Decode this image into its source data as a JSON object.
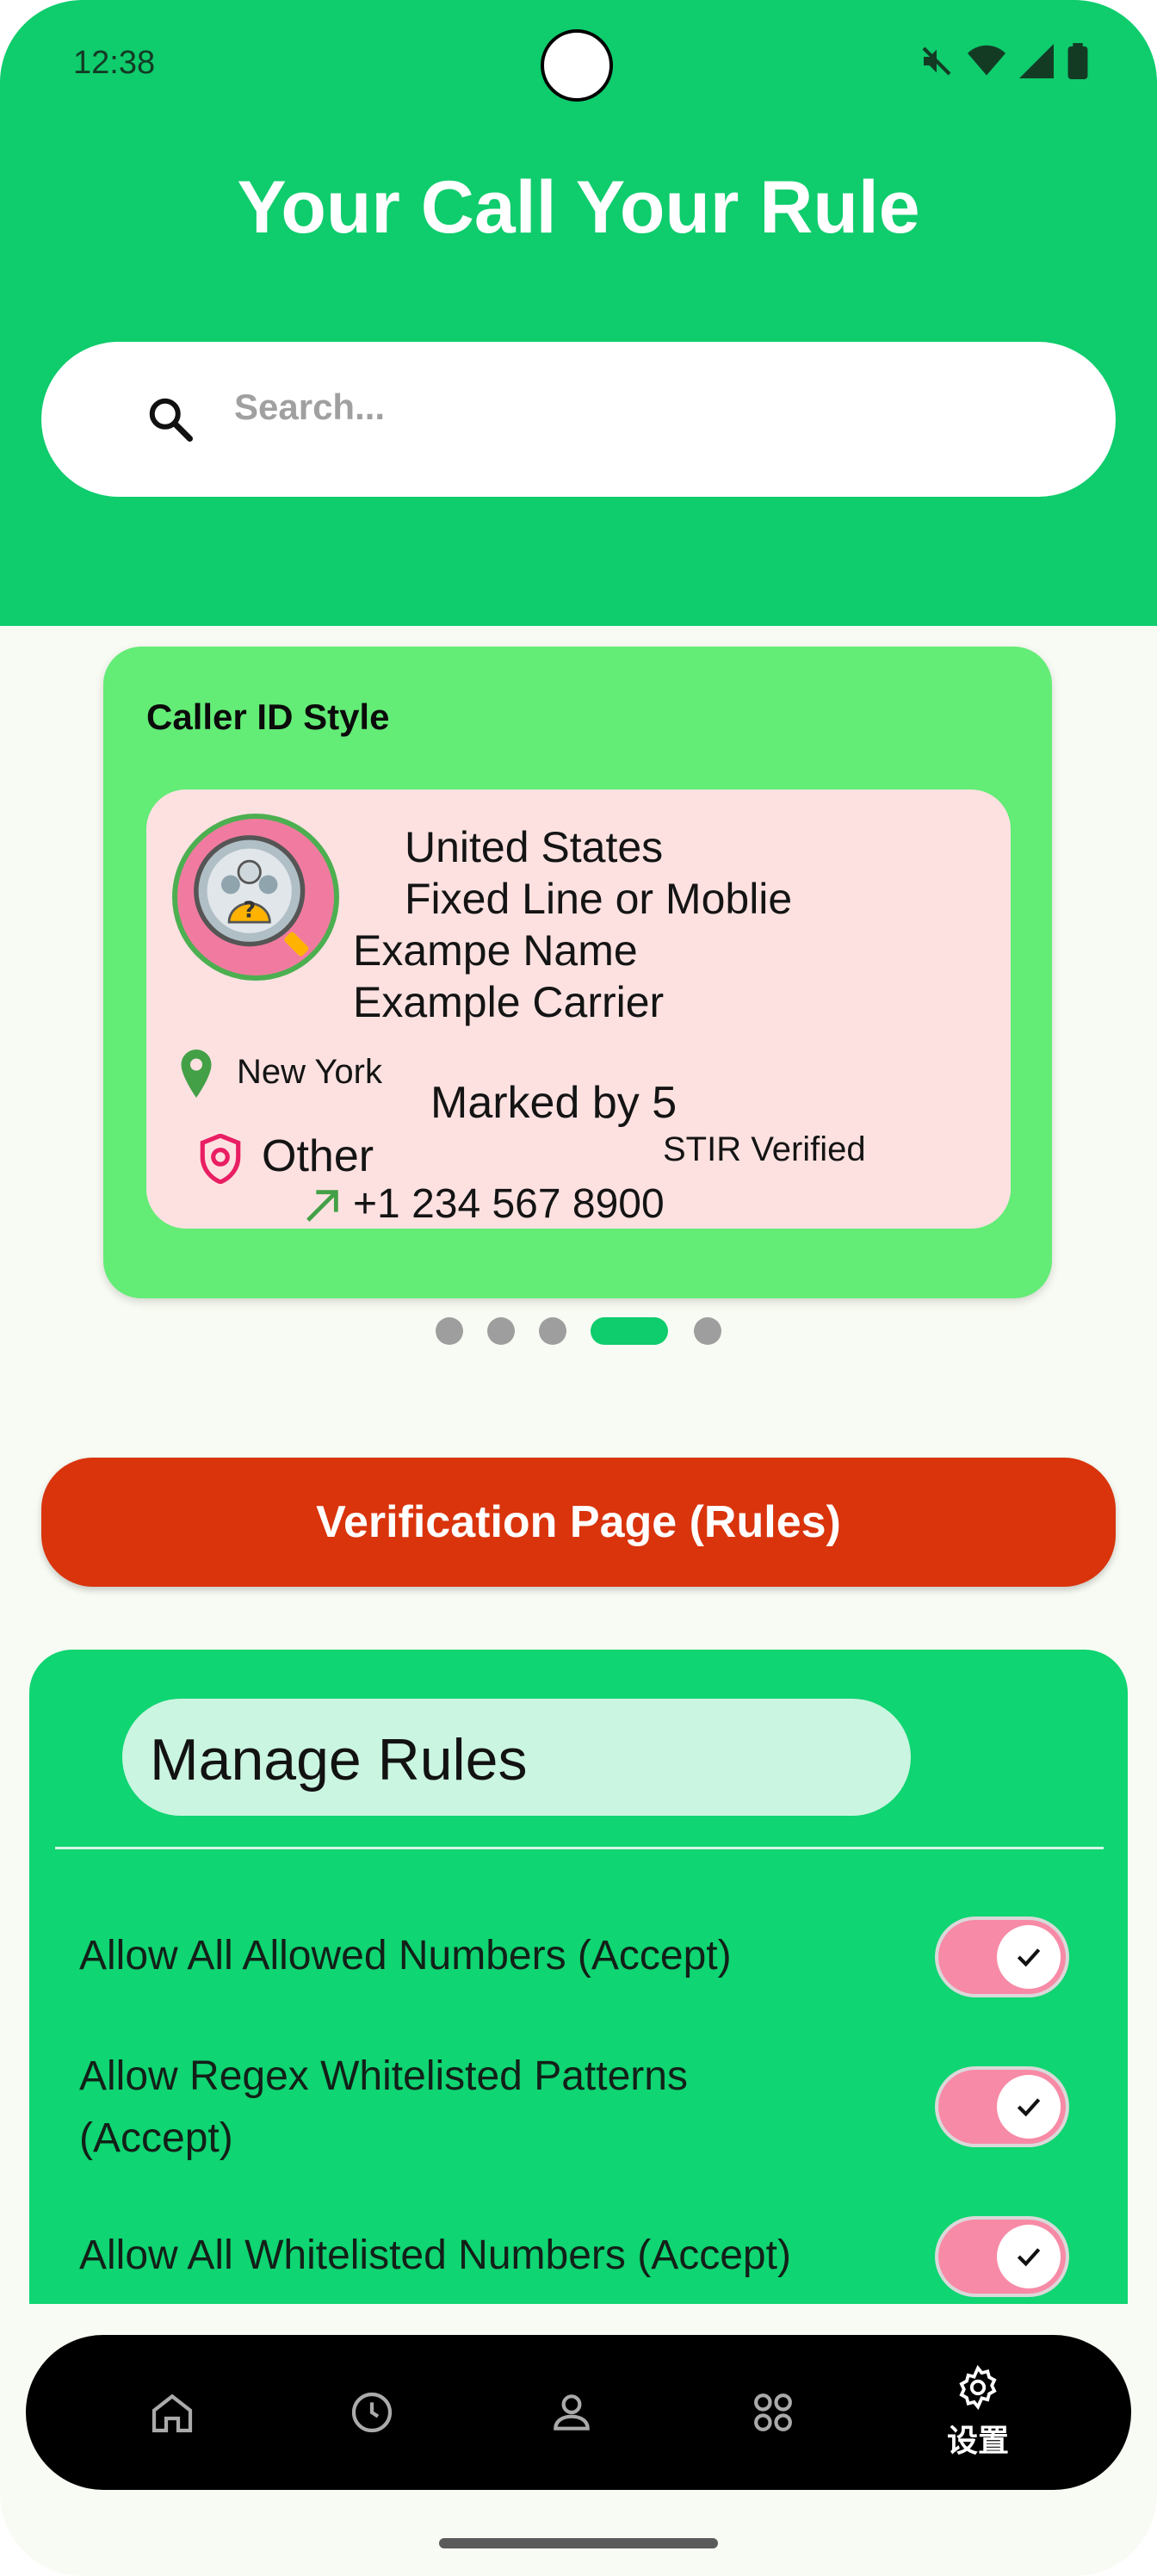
{
  "status_bar": {
    "time": "12:38"
  },
  "header": {
    "title": "Your Call Your Rule",
    "search_placeholder": "Search..."
  },
  "caller_card": {
    "title": "Caller ID Style",
    "country": "United States",
    "line_type": "Fixed Line or Moblie",
    "name": "Exampe Name",
    "carrier": "Example Carrier",
    "city": "New York",
    "marked": "Marked by 5",
    "stir": "STIR Verified",
    "category": "Other",
    "phone": "+1 234 567 8900"
  },
  "carousel": {
    "count": 5,
    "active_index": 3
  },
  "verify_button": {
    "label": "Verification Page (Rules)"
  },
  "rules": {
    "title": "Manage Rules",
    "items": [
      {
        "label": "Allow All Allowed Numbers (Accept)",
        "enabled": true
      },
      {
        "label": "Allow Regex Whitelisted Patterns (Accept)",
        "enabled": true
      },
      {
        "label": "Allow All Whitelisted Numbers (Accept)",
        "enabled": true
      }
    ]
  },
  "nav": {
    "items": [
      {
        "icon": "home-icon",
        "label": ""
      },
      {
        "icon": "history-icon",
        "label": ""
      },
      {
        "icon": "contacts-icon",
        "label": ""
      },
      {
        "icon": "apps-icon",
        "label": ""
      },
      {
        "icon": "settings-icon",
        "label": "设置",
        "active": true
      }
    ]
  },
  "colors": {
    "header_green": "#0fcc6d",
    "card_green": "#63ec76",
    "inner_pink": "#fde1e1",
    "verify_red": "#d9340c",
    "toggle_pink": "#f78aa6"
  }
}
